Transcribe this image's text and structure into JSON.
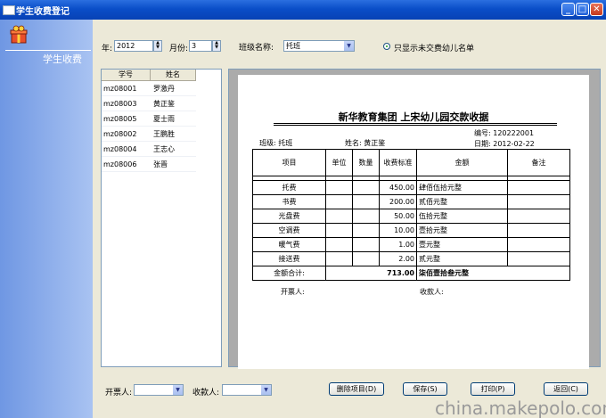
{
  "window": {
    "title": "学生收费登记",
    "min_glyph": "_",
    "max_glyph": "□",
    "close_glyph": "✕"
  },
  "sidebar": {
    "nav_label": "学生收费",
    "icon": "gift-icon"
  },
  "filters": {
    "year_label": "年:",
    "year_value": "2012",
    "month_label": "月份:",
    "month_value": "3",
    "class_label": "班级名称:",
    "class_value": "托班",
    "radio_label": "只显示未交费幼儿名单"
  },
  "student_list": {
    "columns": [
      "学号",
      "姓名"
    ],
    "rows": [
      [
        "mz08001",
        "罗激丹"
      ],
      [
        "mz08003",
        "黄正鉴"
      ],
      [
        "mz08005",
        "夏士雨"
      ],
      [
        "mz08002",
        "王鹏胜"
      ],
      [
        "mz08004",
        "王志心"
      ],
      [
        "mz08006",
        "张晋"
      ]
    ]
  },
  "receipt": {
    "title": "新华教育集团 上宋幼儿园交款收据",
    "number_label": "编号:",
    "number": "120222001",
    "date_label": "日期:",
    "date": "2012-02-22",
    "class_label": "班级:",
    "class_name": "托班",
    "name_label": "姓名:",
    "student_name": "黄正鉴",
    "headers": [
      "项目",
      "单位",
      "数量",
      "收费标准",
      "金额",
      "备注"
    ],
    "items": [
      {
        "item": "托费",
        "rate": "450.00",
        "amount": "肆佰伍拾元整"
      },
      {
        "item": "书费",
        "rate": "200.00",
        "amount": "贰佰元整"
      },
      {
        "item": "光盘费",
        "rate": "50.00",
        "amount": "伍拾元整"
      },
      {
        "item": "空调费",
        "rate": "10.00",
        "amount": "壹拾元整"
      },
      {
        "item": "暖气费",
        "rate": "1.00",
        "amount": "壹元整"
      },
      {
        "item": "接送费",
        "rate": "2.00",
        "amount": "贰元整"
      }
    ],
    "total_label": "金额合计:",
    "total_value": "713.00",
    "total_words": "柒佰壹拾叁元整",
    "issuer_label": "开票人:",
    "receiver_label": "收款人:"
  },
  "footer": {
    "issuer_label": "开票人:",
    "receiver_label": "收款人:",
    "delete_btn": "删除项目(D)",
    "save_btn": "保存(S)",
    "print_btn": "打印(P)",
    "back_btn": "返回(C)"
  },
  "watermark": "china.makepolo.com"
}
